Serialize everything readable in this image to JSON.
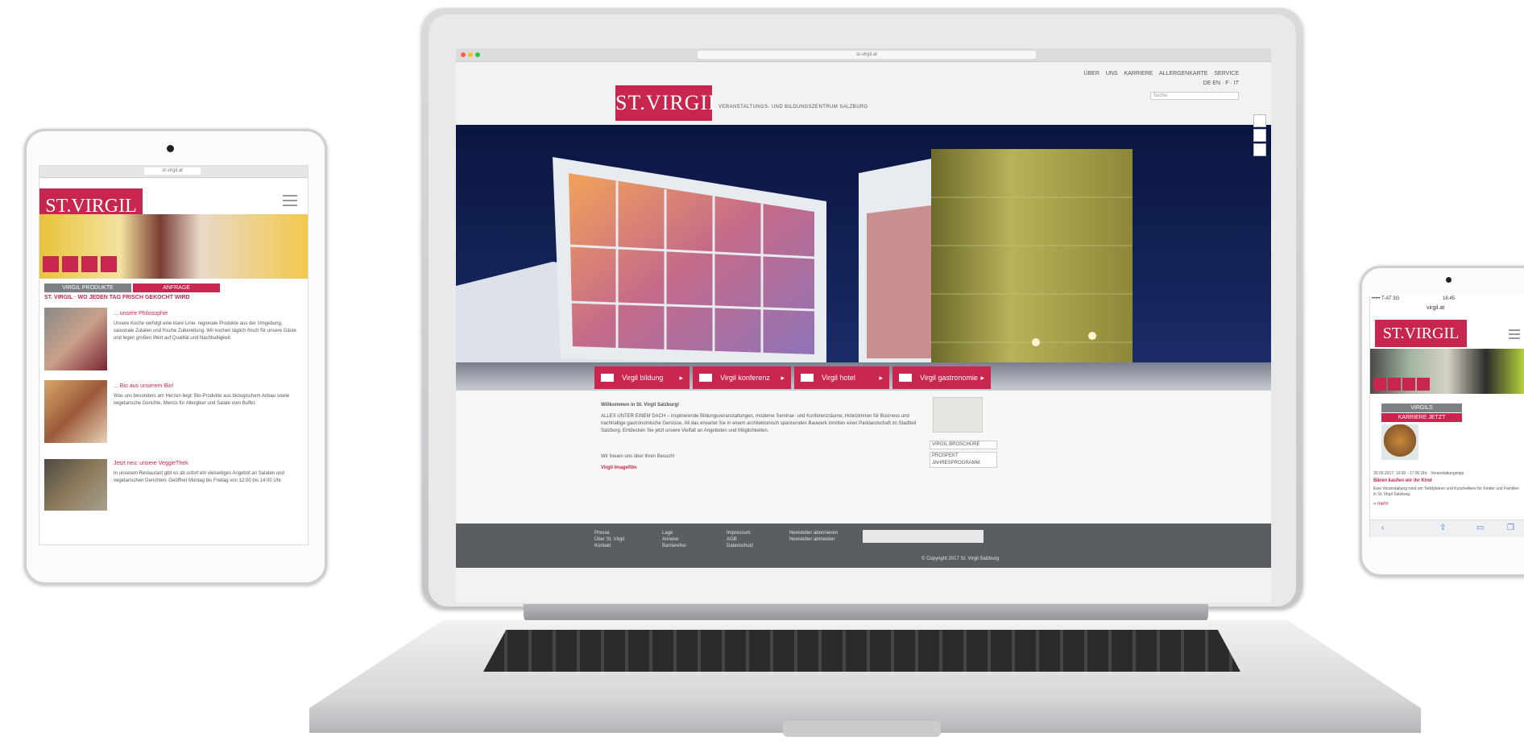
{
  "colors": {
    "brand": "#c8264e",
    "footer": "#5a5e63",
    "night_sky": "#0d1a4c"
  },
  "laptop": {
    "browser_url": "st-virgil.at",
    "top_links": "ÜBER UNS  KARRIERE  ALLERGENKARTE  SERVICE",
    "languages": "DE EN · F · IT",
    "search_placeholder": "Suche",
    "logo_text": "ST.VIRGIL",
    "tagline": "VERANSTALTUNGS- UND BILDUNGSZENTRUM SALZBURG",
    "hero_nav": [
      {
        "label": "Virgil bildung",
        "icon": "people-icon"
      },
      {
        "label": "Virgil konferenz",
        "icon": "presenter-icon"
      },
      {
        "label": "Virgil hotel",
        "icon": "bed-icon"
      },
      {
        "label": "Virgil gastronomie",
        "icon": "cutlery-icon"
      }
    ],
    "welcome_title": "Willkommen in St. Virgil Salzburg!",
    "welcome_text": "ALLES UNTER EINEM DACH – inspirierende Bildungsveranstaltungen, moderne Seminar- und Konferenzräume, Hotelzimmer für Business und nachhaltige gastronomische Genüsse. All das erwartet Sie in einem architektonisch spannenden Bauwerk inmitten einer Parklandschaft im Stadtteil Salzburg. Entdecken Sie jetzt unsere Vielfalt an Angeboten und Möglichkeiten.",
    "welcome_sign": "Wir freuen uns über Ihren Besuch!",
    "welcome_link": "Virgil Imagefilm",
    "side_links": [
      "VIRGIL BROSCHÜRE",
      "PROSPEKT JAHRESPROGRAMM"
    ],
    "footer_cols": [
      [
        "Presse",
        "Über St. Virgil",
        "Kontakt"
      ],
      [
        "Lage",
        "Anreise",
        "Barrierefrei"
      ],
      [
        "Impressum",
        "AGB",
        "Datenschutz"
      ],
      [
        "Newsletter abonnieren",
        "Newsletter abmelden"
      ]
    ],
    "copyright": "© Copyright 2017 St. Virgil Salzburg"
  },
  "tablet": {
    "url": "st-virgil.at",
    "logo_text": "ST.VIRGIL",
    "tabs": [
      "VIRGIL PRODUKTE",
      "ANFRAGE"
    ],
    "headline": "ST. VIRGIL · WO JEDEN TAG FRISCH GEKOCHT WIRD",
    "items": [
      {
        "title": "... unsere Philosophie",
        "text": "Unsere Küche verfolgt eine klare Linie: regionale Produkte aus der Umgebung, saisonale Zutaten und frische Zubereitung. Wir kochen täglich frisch für unsere Gäste und legen großen Wert auf Qualität und Nachhaltigkeit."
      },
      {
        "title": "... Bio aus unserem Bio!",
        "text": "Was uns besonders am Herzen liegt: Bio-Produkte aus biologischem Anbau sowie vegetarische Gerichte, Menüs für Allergiker und Salate vom Buffet."
      },
      {
        "title": "Jetzt neu: unsere VeggieThek",
        "text": "In unserem Restaurant gibt es ab sofort ein vielseitiges Angebot an Salaten und vegetarischen Gerichten. Geöffnet Montag bis Freitag von 12:00 bis 14:00 Uhr."
      }
    ]
  },
  "phone": {
    "status_left": "••••• T-AT  3G",
    "status_time": "16:45",
    "url": "virgil.at",
    "logo_text": "ST.VIRGIL",
    "buttons": [
      "VIRGILS",
      "KARRIERE JETZT"
    ],
    "news_date": "30.09.2017, 10:00 - 17:00 Uhr · Veranstaltungstipp",
    "news_title": "Bären kaufen wir ihr Kind",
    "news_text": "Eine Veranstaltung rund um Teddybären und Kuscheltiere für Kinder und Familien in St. Virgil Salzburg.",
    "news_link": "» mehr"
  }
}
